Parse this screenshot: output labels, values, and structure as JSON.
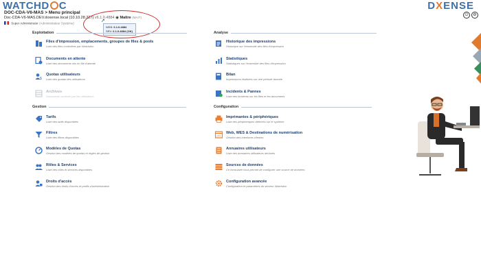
{
  "brand": {
    "left_a": "WATCHD",
    "left_b": "C",
    "right_a": "D",
    "right_x": "X",
    "right_b": "ENSE"
  },
  "header": {
    "line1": "DOC-CDA-V6-MAS > Menu principal",
    "server": "Doc-CDA-V6-MAS.DEV.doxense.local (10.10.28.227)",
    "version": "v6.1.0.4884",
    "mode": "Maître",
    "mode_note": "(MAIT)",
    "user_name": "Super Administrator",
    "user_role": "(Administrateur Système)"
  },
  "tooltip": {
    "line1_label": "WEB:",
    "line1_value": "6.1.0.4884",
    "line2_label": "SRV:",
    "line2_value": "6.1.0.4884 (OK)"
  },
  "sections": {
    "exploitation": "Exploitation",
    "analyse": "Analyse",
    "gestion": "Gestion",
    "configuration": "Configuration"
  },
  "items": {
    "files": {
      "title": "Files d'impression, emplacements, groupes de files & pools",
      "desc": "Liste des files contrôlées par Watchdoc"
    },
    "documents": {
      "title": "Documents en attente",
      "desc": "Liste des documents mis en file d'attente"
    },
    "quotas": {
      "title": "Quotas utilisateurs",
      "desc": "Liste des quotas des utilisateurs"
    },
    "archives": {
      "title": "Archives",
      "desc": "Documents archivés par les utilisateurs"
    },
    "historique": {
      "title": "Historique des impressions",
      "desc": "Historique sur l'ensemble des files d'impression"
    },
    "statistiques": {
      "title": "Statistiques",
      "desc": "Statistiques sur l'ensemble des files d'impression"
    },
    "bilan": {
      "title": "Bilan",
      "desc": "Impressions réalisées sur une période donnée"
    },
    "incidents": {
      "title": "Incidents & Pannes",
      "desc": "Liste des incidents sur les files et les documents"
    },
    "tarifs": {
      "title": "Tarifs",
      "desc": "Liste des tarifs disponibles"
    },
    "filtres": {
      "title": "Filtres",
      "desc": "Liste des filtres disponibles"
    },
    "modeles": {
      "title": "Modèles de Quotas",
      "desc": "Gestion des modèles de quotas et règles de gestion"
    },
    "roles": {
      "title": "Rôles & Services",
      "desc": "Liste des rôles et services disponibles"
    },
    "droits": {
      "title": "Droits d'accès",
      "desc": "Gestion des droits d'accès et profils d'administration"
    },
    "imprimantes": {
      "title": "Imprimantes & périphériques",
      "desc": "Liste des périphériques détectés sur le système"
    },
    "web": {
      "title": "Web, WES & Destinations de numérisation",
      "desc": "Gestion des interfaces clientes"
    },
    "annuaires": {
      "title": "Annuaires utilisateurs",
      "desc": "Liste des annuaires utilisateurs déclarés"
    },
    "sources": {
      "title": "Sources de données",
      "desc": "Ce formulaire vous permet de configurer une source de données"
    },
    "config": {
      "title": "Configuration avancée",
      "desc": "Configuration et paramètres du serveur Watchdoc"
    }
  },
  "icons": {
    "accent_blue": "#3b73c4",
    "accent_orange": "#ef7d2e",
    "annotation_red": "#d12b2b"
  }
}
